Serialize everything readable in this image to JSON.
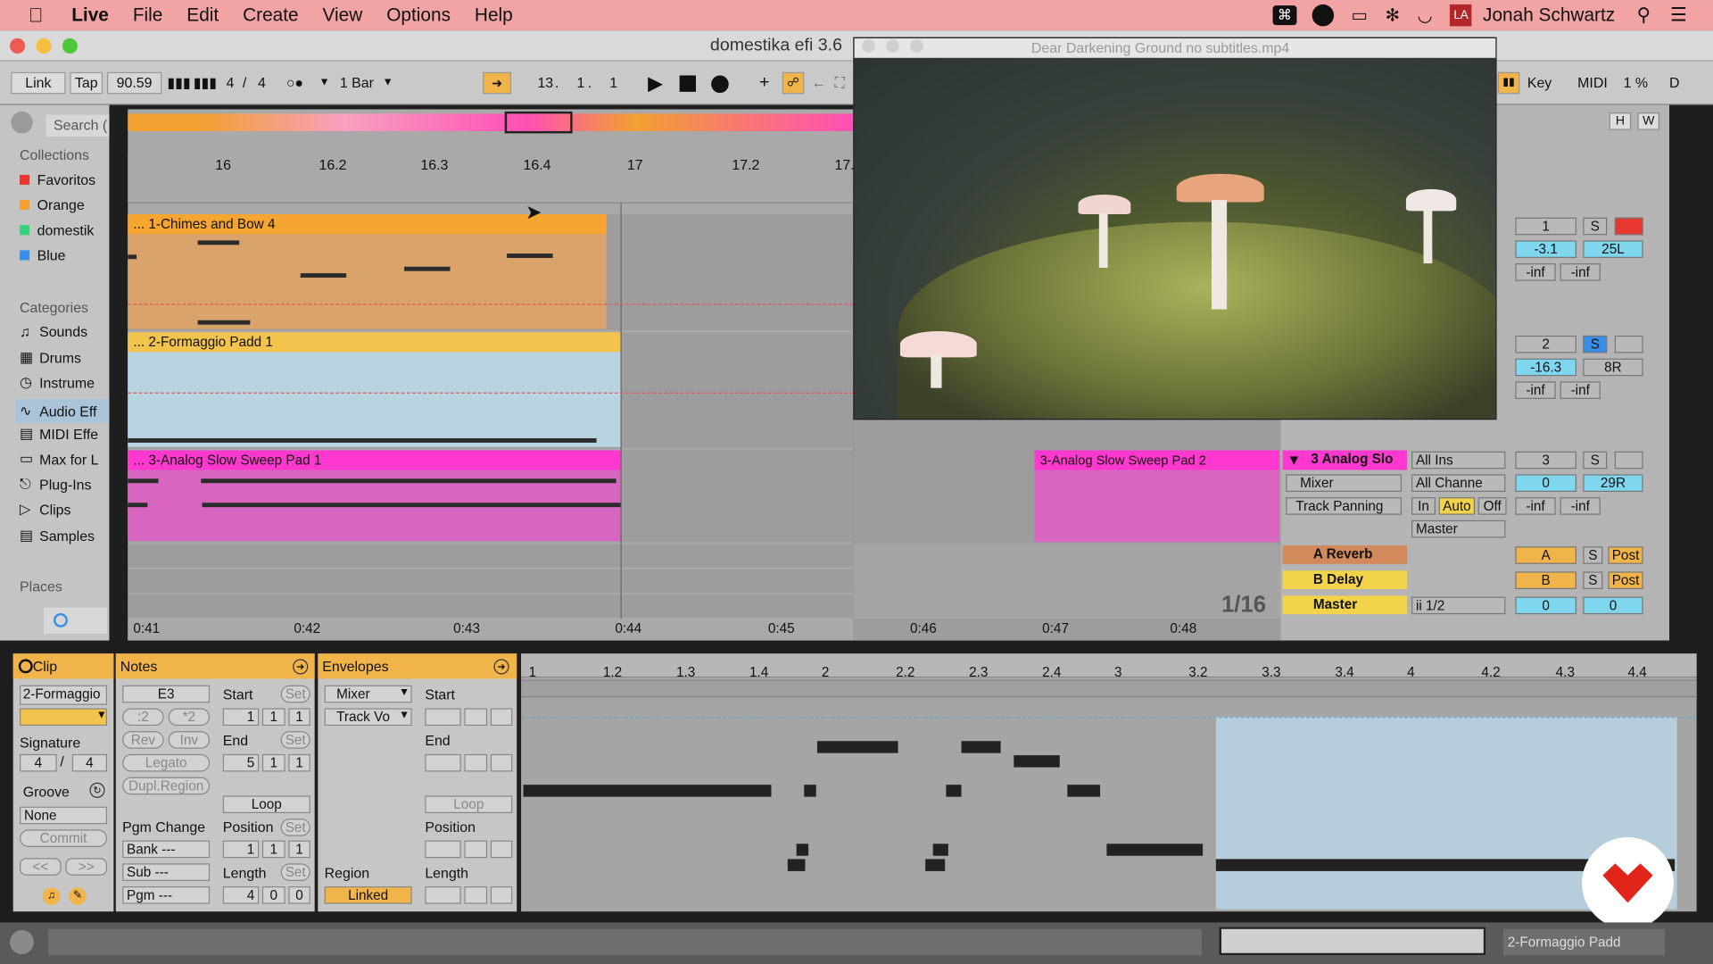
{
  "menubar": {
    "app": "Live",
    "items": [
      "File",
      "Edit",
      "Create",
      "View",
      "Options",
      "Help"
    ],
    "user": "Jonah Schwartz"
  },
  "window": {
    "title": "domestika efi 3.6"
  },
  "video": {
    "title": "Dear Darkening Ground no subtitles.mp4"
  },
  "transport": {
    "link": "Link",
    "tap": "Tap",
    "tempo": "90.59",
    "sig_num": "4",
    "sig_sep": "/",
    "sig_den": "4",
    "quantize": "1 Bar",
    "pos_bar": "13",
    "pos_beat": "1",
    "pos_sixteenth": "1",
    "key": "Key",
    "midi": "MIDI",
    "cpu": "1 %",
    "d": "D",
    "h": "H",
    "w": "W"
  },
  "browser": {
    "search_placeholder": "Search (",
    "collections_title": "Collections",
    "collections": [
      {
        "label": "Favoritos",
        "color": "#e8372f"
      },
      {
        "label": "Orange",
        "color": "#f2a031"
      },
      {
        "label": "domestik",
        "color": "#38d27e"
      },
      {
        "label": "Blue",
        "color": "#3a8ee8"
      }
    ],
    "categories_title": "Categories",
    "categories": [
      "Sounds",
      "Drums",
      "Instrume",
      "Audio Eff",
      "MIDI Effe",
      "Max for L",
      "Plug-Ins",
      "Clips",
      "Samples"
    ],
    "places_title": "Places"
  },
  "ruler": {
    "bars": [
      "16",
      "16.2",
      "16.3",
      "16.4",
      "17",
      "17.2",
      "17."
    ],
    "times": [
      "0:41",
      "0:42",
      "0:43",
      "0:44",
      "0:45",
      "0:46",
      "0:47",
      "0:48"
    ]
  },
  "tracks": [
    {
      "clip": "... 1-Chimes and Bow 4",
      "num": "1",
      "solo": "S",
      "vol": "-3.1",
      "pan": "25L",
      "inf1": "-inf",
      "inf2": "-inf"
    },
    {
      "clip": "... 2-Formaggio Padd 1",
      "num": "2",
      "solo": "S",
      "vol": "-16.3",
      "pan": "8R",
      "inf1": "-inf",
      "inf2": "-inf"
    },
    {
      "clip": "... 3-Analog Slow Sweep Pad 1",
      "clip2": "3-Analog Slow Sweep Pad 2",
      "name": "3 Analog Slo",
      "input": "All Ins",
      "device": "Mixer",
      "channel": "All Channe",
      "param": "Track Panning",
      "in": "In",
      "auto": "Auto",
      "off": "Off",
      "output": "Master",
      "num": "3",
      "solo": "S",
      "vol": "0",
      "pan": "29R",
      "inf1": "-inf",
      "inf2": "-inf"
    }
  ],
  "returns": [
    {
      "name": "A Reverb",
      "letter": "A",
      "solo": "S",
      "post": "Post"
    },
    {
      "name": "B Delay",
      "letter": "B",
      "solo": "S",
      "post": "Post"
    },
    {
      "name": "Master",
      "cue": "ii 1/2",
      "vol": "0",
      "pan": "0"
    }
  ],
  "grid_label": "1/16",
  "clip_panel": {
    "title": "Clip",
    "name": "2-Formaggio",
    "signature_label": "Signature",
    "sig_num": "4",
    "sig_den": "4",
    "groove_label": "Groove",
    "groove_value": "None",
    "commit": "Commit",
    "prev": "<<",
    "next": ">>"
  },
  "notes_panel": {
    "title": "Notes",
    "key": "E3",
    "div2": ":2",
    "mul2": "*2",
    "rev": "Rev",
    "inv": "Inv",
    "legato": "Legato",
    "dupl": "Dupl.Region",
    "pgm_change": "Pgm Change",
    "bank": "Bank ---",
    "sub": "Sub ---",
    "pgm": "Pgm ---",
    "start_label": "Start",
    "set": "Set",
    "start": [
      "1",
      "1",
      "1"
    ],
    "end_label": "End",
    "end": [
      "5",
      "1",
      "1"
    ],
    "loop": "Loop",
    "position_label": "Position",
    "position": [
      "1",
      "1",
      "1"
    ],
    "length_label": "Length",
    "length": [
      "4",
      "0",
      "0"
    ]
  },
  "envelopes_panel": {
    "title": "Envelopes",
    "device": "Mixer",
    "control": "Track Vo",
    "region_label": "Region",
    "linked": "Linked",
    "start_label": "Start",
    "end_label": "End",
    "loop": "Loop",
    "position_label": "Position",
    "length_label": "Length"
  },
  "piano_ruler": [
    "1",
    "1.2",
    "1.3",
    "1.4",
    "2",
    "2.2",
    "2.3",
    "2.4",
    "3",
    "3.2",
    "3.3",
    "3.4",
    "4",
    "4.2",
    "4.3",
    "4.4"
  ],
  "status": {
    "clip_name": "2-Formaggio Padd"
  },
  "colors": {
    "orange_clip": "#f6a531",
    "yellow_clip": "#f2c44e",
    "pink_clip": "#ff38d0",
    "accent_orange": "#f0b44a",
    "blue": "#7fd7ef",
    "menubar": "#f2a3a3"
  }
}
